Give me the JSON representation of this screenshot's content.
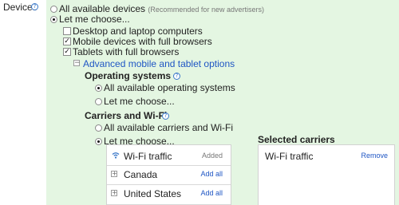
{
  "section": {
    "label": "Devices"
  },
  "device_options": {
    "all_devices": {
      "label": "All available devices",
      "note": "(Recommended for new advertisers)",
      "selected": false
    },
    "let_me_choose": {
      "label": "Let me choose...",
      "selected": true
    }
  },
  "device_types": [
    {
      "label": "Desktop and laptop computers",
      "checked": false
    },
    {
      "label": "Mobile devices with full browsers",
      "checked": true
    },
    {
      "label": "Tablets with full browsers",
      "checked": true
    }
  ],
  "advanced": {
    "label": "Advanced mobile and tablet options",
    "toggle": "−"
  },
  "operating_systems": {
    "heading": "Operating systems",
    "options": [
      {
        "label": "All available operating systems",
        "selected": true
      },
      {
        "label": "Let me choose...",
        "selected": false
      }
    ]
  },
  "carriers": {
    "heading": "Carriers and Wi-Fi",
    "options": [
      {
        "label": "All available carriers and Wi-Fi",
        "selected": false
      },
      {
        "label": "Let me choose...",
        "selected": true
      }
    ],
    "available": [
      {
        "label": "Wi-Fi traffic",
        "action": "Added",
        "icon": "wifi-icon"
      },
      {
        "label": "Canada",
        "action": "Add all",
        "icon": "expand-icon"
      },
      {
        "label": "United States",
        "action": "Add all",
        "icon": "expand-icon"
      }
    ]
  },
  "selected_carriers": {
    "heading": "Selected carriers",
    "items": [
      {
        "label": "Wi-Fi traffic",
        "action": "Remove"
      }
    ]
  },
  "glyphs": {
    "help": "?",
    "check": "✓",
    "expand": "+"
  },
  "colors": {
    "panel": "#e4f6e2",
    "link": "#1f56c4",
    "help": "#3a78c8"
  }
}
